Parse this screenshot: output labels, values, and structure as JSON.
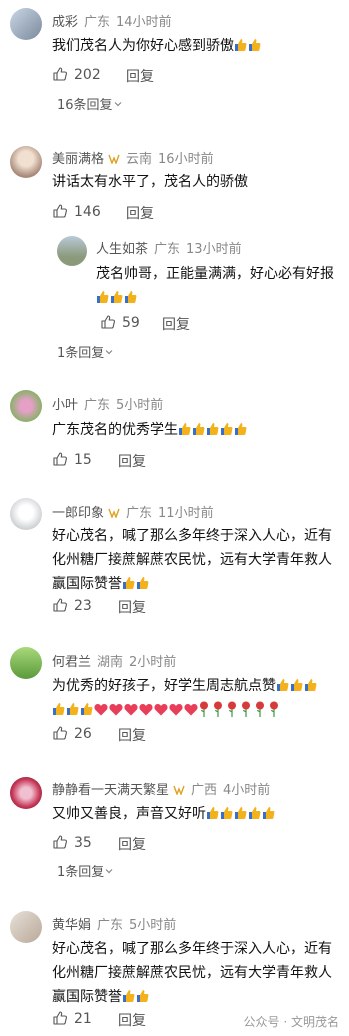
{
  "comments": [
    {
      "name": "成彩",
      "location": "广东",
      "time": "14小时前",
      "text": "我们茂名人为你好心感到骄傲",
      "likes": "202",
      "reply_label": "回复",
      "more": "16条回复"
    },
    {
      "name": "美丽满格",
      "location": "云南",
      "time": "16小时前",
      "text": "讲话太有水平了，茂名人的骄傲",
      "likes": "146",
      "reply_label": "回复",
      "reply": {
        "name": "人生如茶",
        "location": "广东",
        "time": "13小时前",
        "text": "茂名帅哥，正能量满满，好心必有好报",
        "likes": "59",
        "reply_label": "回复"
      },
      "more": "1条回复"
    },
    {
      "name": "小叶",
      "location": "广东",
      "time": "5小时前",
      "text": "广东茂名的优秀学生",
      "likes": "15",
      "reply_label": "回复"
    },
    {
      "name": "一郎印象",
      "location": "广东",
      "time": "11小时前",
      "text_line1": "好心茂名，喊了那么多年终于深入人心，近有",
      "text_line2": "化州糖厂接蔗解蔗农民忧，远有大学青年救人",
      "text_line3": "赢国际赞誉",
      "likes": "23",
      "reply_label": "回复"
    },
    {
      "name": "何君兰",
      "location": "湖南",
      "time": "2小时前",
      "text": "为优秀的好孩子，好学生周志航点赞",
      "likes": "26",
      "reply_label": "回复"
    },
    {
      "name": "静静看一天满天繁星",
      "location": "广西",
      "time": "4小时前",
      "text": "又帅又善良，声音又好听",
      "likes": "35",
      "reply_label": "回复",
      "more": "1条回复"
    },
    {
      "name": "黄华娟",
      "location": "广东",
      "time": "5小时前",
      "text_line1": "好心茂名，喊了那么多年终于深入人心，近有",
      "text_line2": "化州糖厂接蔗解蔗农民忧，远有大学青年救人",
      "text_line3": "赢国际赞誉",
      "likes": "21",
      "reply_label": "回复"
    }
  ],
  "watermark": "公众号 · 文明茂名",
  "icons": {
    "like": "thumbs-up-icon",
    "chevron": "chevron-down-icon",
    "emoji": "thumbs-up-emoji",
    "badge": "vip-badge-icon"
  },
  "colors": {
    "emoji": "#f3b11c",
    "heart": "#e83e5a",
    "rose": "#d63a3a"
  }
}
